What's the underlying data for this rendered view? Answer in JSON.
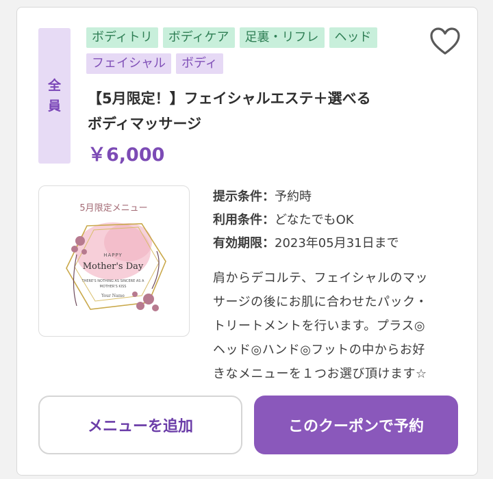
{
  "side_label": [
    "全",
    "員"
  ],
  "tags": [
    {
      "label": "ボディトリ",
      "color": "green"
    },
    {
      "label": "ボディケア",
      "color": "green"
    },
    {
      "label": "足裏・リフレ",
      "color": "green"
    },
    {
      "label": "ヘッド",
      "color": "green"
    },
    {
      "label": "フェイシャル",
      "color": "purple"
    },
    {
      "label": "ボディ",
      "color": "purple"
    }
  ],
  "title_line1": "【5月限定！】フェイシャルエステ＋選べる",
  "title_line2": "ボディマッサージ",
  "price": "￥6,000",
  "thumbnail": {
    "heading": "5月限定メニュー",
    "happy": "HAPPY",
    "mothers_day": "Mother's Day",
    "small1": "THERE'S NOTHING AS SINCERE AS A",
    "small2": "MOTHER'S KISS",
    "name": "Your Name"
  },
  "conditions": [
    {
      "key": "提示条件：",
      "value": "予約時"
    },
    {
      "key": "利用条件：",
      "value": "どなたでもOK"
    },
    {
      "key": "有効期限：",
      "value": "2023年05月31日まで"
    }
  ],
  "description_lines": [
    "肩からデコルテ、フェイシャルのマッ",
    "サージの後にお肌に合わせたパック・",
    "トリートメントを行います。プラス◎",
    "ヘッド◎ハンド◎フットの中からお好",
    "きなメニューを１つお選び頂けます☆"
  ],
  "buttons": {
    "add_menu": "メニューを追加",
    "book": "このクーポンで予約"
  },
  "colors": {
    "accent": "#8a58bb",
    "tag_green_bg": "#c8efdb",
    "tag_purple_bg": "#e6d9f5",
    "price": "#7c4bb5"
  }
}
